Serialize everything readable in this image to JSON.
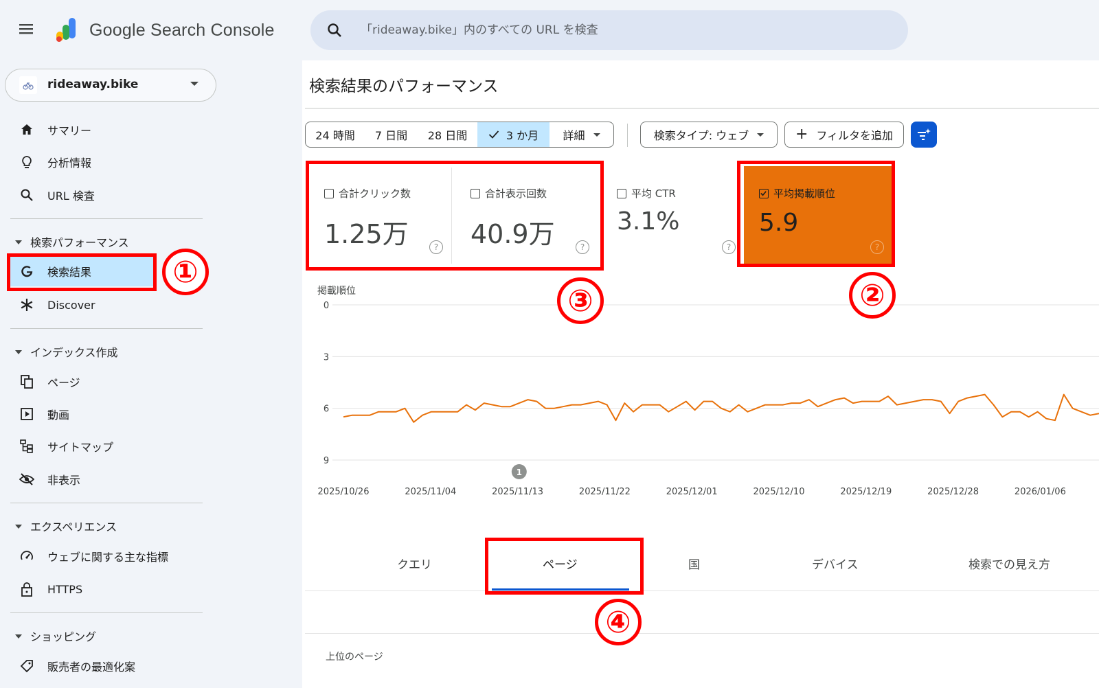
{
  "header": {
    "app_title": "Google Search Console",
    "search_placeholder": "「rideaway.bike」内のすべての URL を検査"
  },
  "property": {
    "label": "rideaway.bike"
  },
  "sidebar": {
    "items_top": [
      {
        "label": "サマリー",
        "icon": "home-icon"
      },
      {
        "label": "分析情報",
        "icon": "lightbulb-icon"
      },
      {
        "label": "URL 検査",
        "icon": "search-icon"
      }
    ],
    "section_performance": "検索パフォーマンス",
    "performance_items": [
      {
        "label": "検索結果",
        "icon": "google-g-icon",
        "active": true
      },
      {
        "label": "Discover",
        "icon": "asterisk-icon"
      }
    ],
    "section_index": "インデックス作成",
    "index_items": [
      {
        "label": "ページ",
        "icon": "pages-icon"
      },
      {
        "label": "動画",
        "icon": "video-icon"
      },
      {
        "label": "サイトマップ",
        "icon": "sitemap-icon"
      },
      {
        "label": "非表示",
        "icon": "eye-off-icon"
      }
    ],
    "section_experience": "エクスペリエンス",
    "experience_items": [
      {
        "label": "ウェブに関する主な指標",
        "icon": "gauge-icon"
      },
      {
        "label": "HTTPS",
        "icon": "lock-icon"
      }
    ],
    "section_shopping": "ショッピング",
    "shopping_items": [
      {
        "label": "販売者の最適化案",
        "icon": "tag-icon"
      }
    ]
  },
  "main": {
    "page_title": "検索結果のパフォーマンス",
    "date_chips": [
      "24 時間",
      "7 日間",
      "28 日間",
      "3 か月",
      "詳細"
    ],
    "selected_chip": "3 か月",
    "search_type_chip": "検索タイプ: ウェブ",
    "add_filter_chip": "フィルタを追加",
    "metrics": [
      {
        "label": "合計クリック数",
        "value": "1.25万",
        "checked": false
      },
      {
        "label": "合計表示回数",
        "value": "40.9万",
        "checked": false
      },
      {
        "label": "平均 CTR",
        "value": "3.1%",
        "checked": false
      },
      {
        "label": "平均掲載順位",
        "value": "5.9",
        "checked": true
      }
    ],
    "help_glyph": "?",
    "tabs": [
      "クエリ",
      "ページ",
      "国",
      "デバイス",
      "検索での見え方"
    ],
    "active_tab": "ページ",
    "table_heading": "上位のページ"
  },
  "annotations": [
    "①",
    "②",
    "③",
    "④"
  ],
  "colors": {
    "accent": "#0b57d0",
    "selected_bg": "#c2e7ff",
    "position_metric": "#e8710a",
    "annotation_red": "#ff0000"
  },
  "chart_data": {
    "type": "line",
    "title": "",
    "ylabel": "掲載順位",
    "xlabel": "",
    "y_reversed": true,
    "ylim": [
      0,
      9
    ],
    "yticks": [
      0,
      3,
      6,
      9
    ],
    "xtick_labels": [
      "2025/10/26",
      "2025/11/04",
      "2025/11/13",
      "2025/11/22",
      "2025/12/01",
      "2025/12/10",
      "2025/12/19",
      "2025/12/28",
      "2026/01/06"
    ],
    "event_marker": {
      "label": "1",
      "x_index": 20
    },
    "grid": true,
    "legend": "none",
    "series": [
      {
        "values": [
          6.5,
          6.4,
          6.4,
          6.4,
          6.2,
          6.2,
          6.2,
          6.0,
          6.8,
          6.4,
          6.2,
          6.2,
          6.2,
          6.2,
          5.8,
          6.1,
          5.7,
          5.8,
          5.9,
          5.9,
          5.7,
          5.5,
          5.6,
          6.0,
          6.0,
          5.9,
          5.8,
          5.8,
          5.7,
          5.6,
          5.8,
          6.7,
          5.7,
          6.2,
          5.8,
          5.8,
          5.8,
          6.2,
          5.9,
          5.6,
          6.1,
          5.6,
          5.6,
          6.0,
          6.2,
          5.8,
          6.2,
          6.0,
          5.8,
          5.8,
          5.8,
          5.7,
          5.7,
          5.5,
          5.9,
          5.7,
          5.5,
          5.4,
          5.7,
          5.6,
          5.6,
          5.6,
          5.3,
          5.8,
          5.7,
          5.6,
          5.5,
          5.5,
          5.6,
          6.3,
          5.6,
          5.4,
          5.3,
          5.2,
          5.8,
          6.5,
          6.2,
          6.2,
          6.5,
          6.2,
          6.6,
          6.7,
          5.2,
          6.0,
          6.2,
          6.4,
          6.3
        ]
      }
    ]
  }
}
